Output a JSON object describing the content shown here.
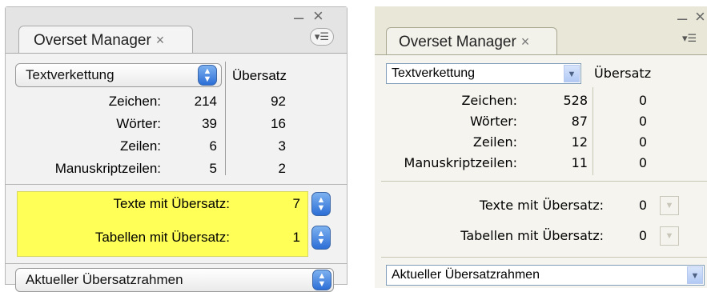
{
  "panel_a": {
    "tab_title": "Overset Manager",
    "tab_close": "×",
    "window_minimize": "–",
    "window_close": "×",
    "menu_icon": "▾☰",
    "dropdown_value": "Textverkettung",
    "oversat_header": "Übersatz",
    "stats": [
      {
        "label": "Zeichen:",
        "value": "214",
        "overset": "92"
      },
      {
        "label": "Wörter:",
        "value": "39",
        "overset": "16"
      },
      {
        "label": "Zeilen:",
        "value": "6",
        "overset": "3"
      },
      {
        "label": "Manuskriptzeilen:",
        "value": "5",
        "overset": "2"
      }
    ],
    "texts_label": "Texte mit Übersatz:",
    "texts_value": "7",
    "tables_label": "Tabellen mit Übersatz:",
    "tables_value": "1",
    "frame_dropdown": "Aktueller Übersatzrahmen"
  },
  "panel_b": {
    "tab_title": "Overset Manager",
    "tab_close": "×",
    "window_minimize": "–",
    "window_close": "×",
    "menu_icon": "▾☰",
    "dropdown_value": "Textverkettung",
    "oversat_header": "Übersatz",
    "stats": [
      {
        "label": "Zeichen:",
        "value": "528",
        "overset": "0"
      },
      {
        "label": "Wörter:",
        "value": "87",
        "overset": "0"
      },
      {
        "label": "Zeilen:",
        "value": "12",
        "overset": "0"
      },
      {
        "label": "Manuskriptzeilen:",
        "value": "11",
        "overset": "0"
      }
    ],
    "texts_label": "Texte mit Übersatz:",
    "texts_value": "0",
    "tables_label": "Tabellen mit Übersatz:",
    "tables_value": "0",
    "frame_dropdown": "Aktueller Übersatzrahmen"
  },
  "icons": {
    "stepper": "▲▼",
    "dropdown_arrow": "▼"
  },
  "colors": {
    "highlight": "#ffff58",
    "mac_accent": "#2c6ed6",
    "win_accent": "#b1c9f4"
  }
}
